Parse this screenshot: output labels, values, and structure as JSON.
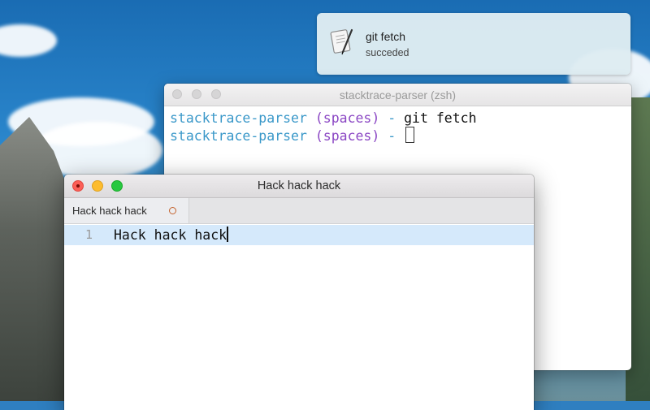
{
  "notification": {
    "title": "git fetch",
    "subtitle": "succeded",
    "icon": "script-editor-icon"
  },
  "terminal": {
    "title": "stacktrace-parser (zsh)",
    "lines": [
      {
        "dir": "stacktrace-parser",
        "branch": "(spaces)",
        "sep": "-",
        "command": "git fetch"
      },
      {
        "dir": "stacktrace-parser",
        "branch": "(spaces)",
        "sep": "-",
        "command": ""
      }
    ]
  },
  "editor": {
    "title": "Hack hack hack",
    "tab": {
      "label": "Hack hack hack",
      "modified": true
    },
    "lines": [
      {
        "number": "1",
        "text": "Hack hack hack"
      }
    ]
  },
  "colors": {
    "prompt_dir": "#3a98c9",
    "prompt_branch": "#8b47c4",
    "current_line": "#d5e9fb",
    "modified_dot": "#c4622d"
  }
}
